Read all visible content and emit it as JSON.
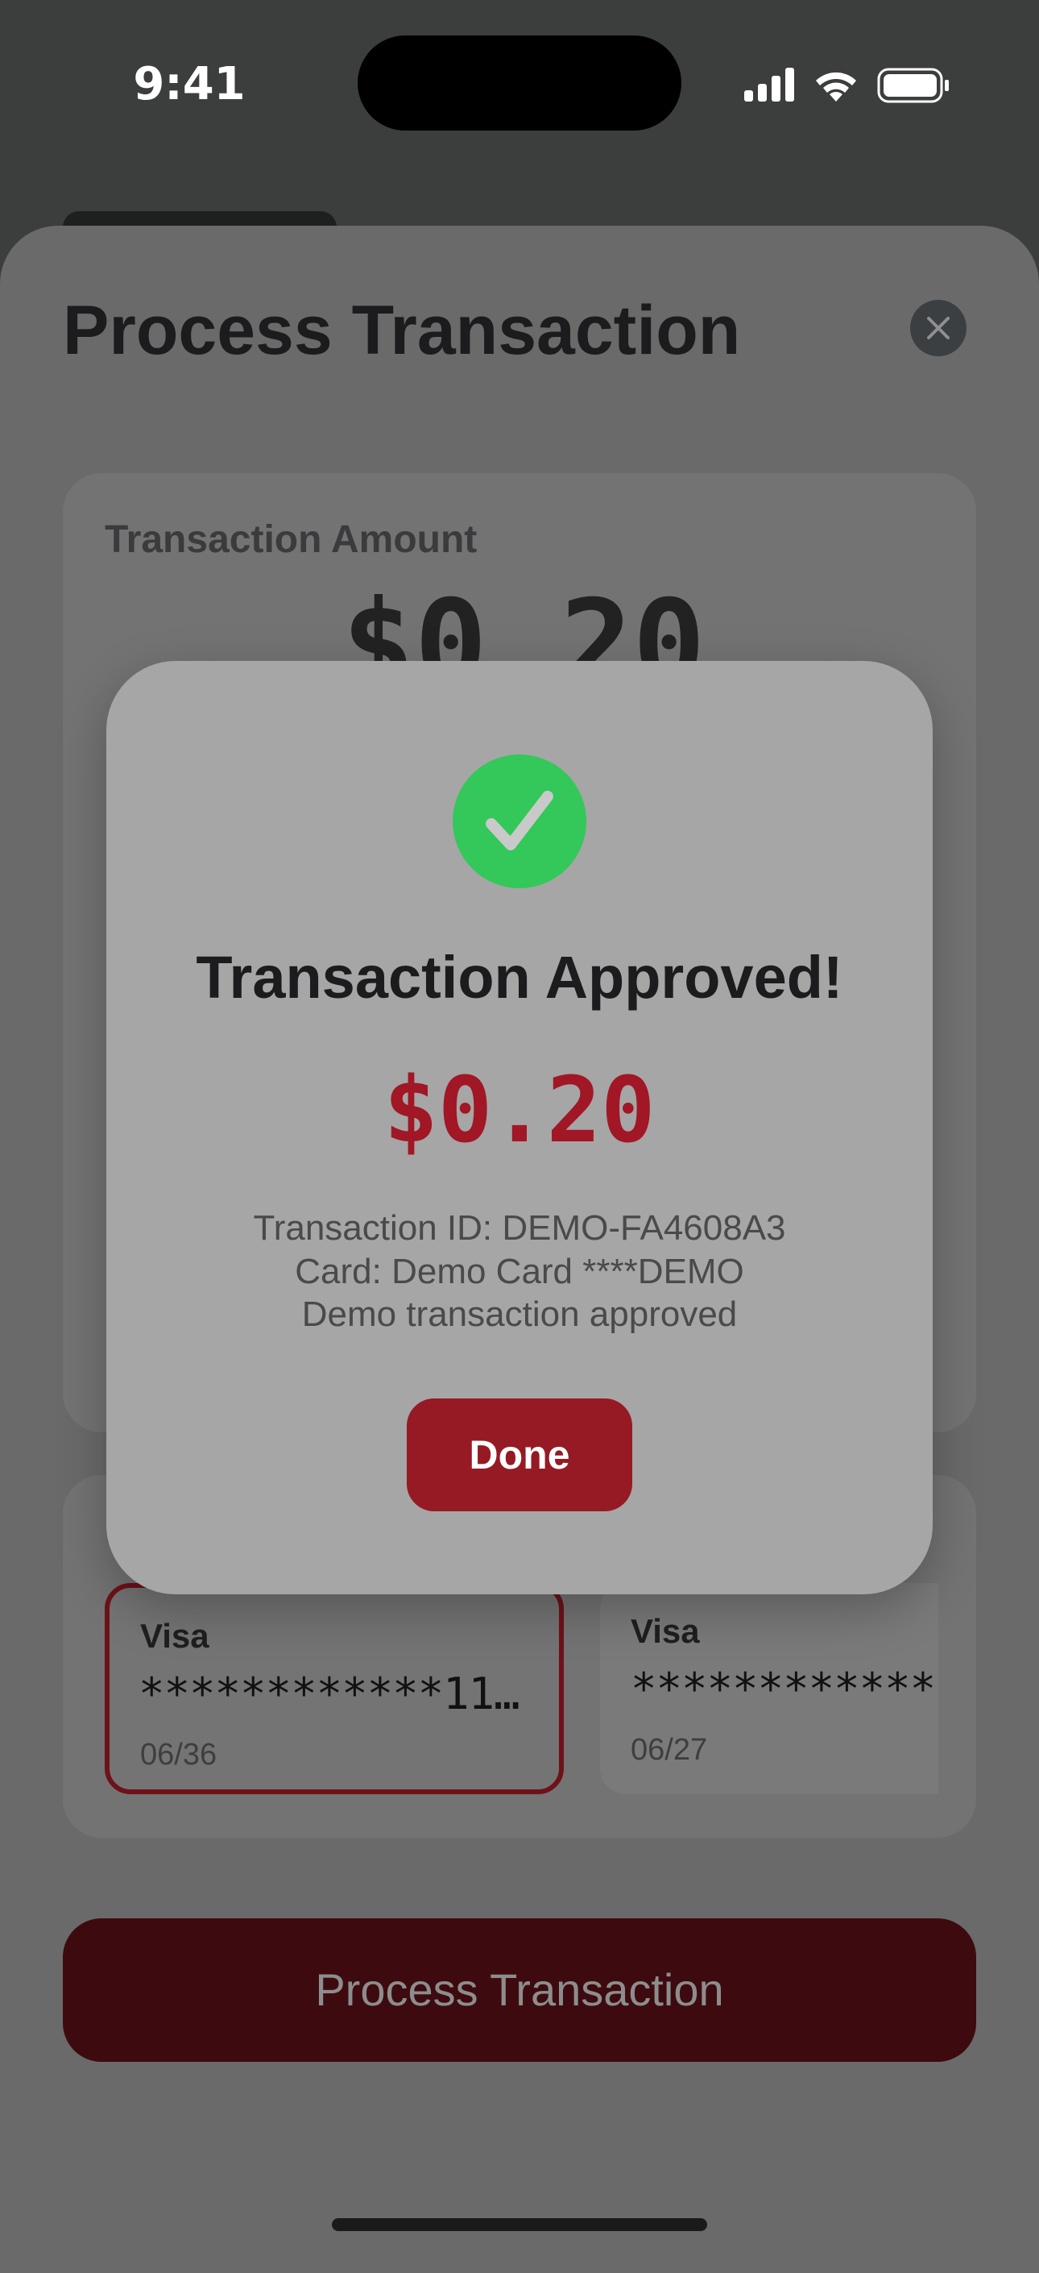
{
  "status_bar": {
    "time": "9:41",
    "icons": [
      "cellular-signal-icon",
      "wifi-icon",
      "battery-icon"
    ]
  },
  "sheet": {
    "title": "Process Transaction",
    "close_icon": "close-icon",
    "amount_card": {
      "label": "Transaction Amount",
      "value": "$0.20"
    },
    "cards": [
      {
        "brand": "Visa",
        "number": "************11…",
        "expiry": "06/36",
        "selected": true
      },
      {
        "brand": "Visa",
        "number": "************",
        "expiry": "06/27",
        "selected": false
      }
    ],
    "process_button": "Process Transaction"
  },
  "modal": {
    "icon": "checkmark-icon",
    "title": "Transaction Approved!",
    "amount": "$0.20",
    "details": [
      "Transaction ID: DEMO-FA4608A3",
      "Card: Demo Card ****DEMO",
      "Demo transaction approved"
    ],
    "done_button": "Done"
  },
  "colors": {
    "accent": "#961a24",
    "amount_red": "#a11725",
    "success_green": "#34c759",
    "modal_bg": "#a6a6a6"
  }
}
